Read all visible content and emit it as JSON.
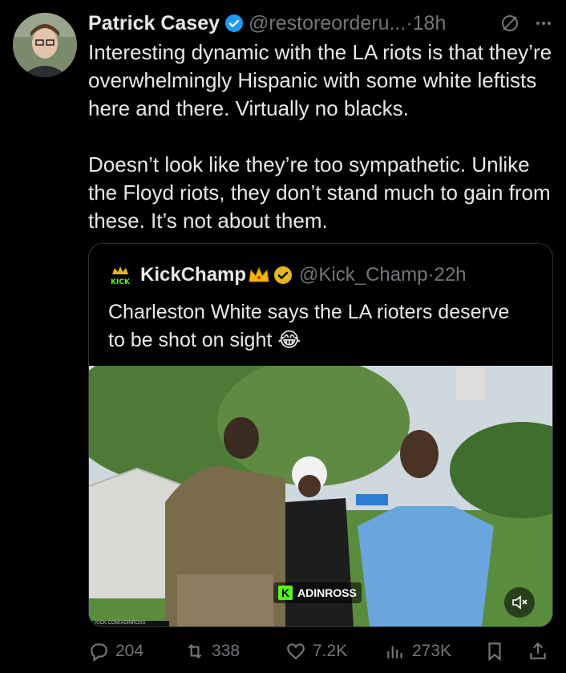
{
  "tweet": {
    "author_name": "Patrick Casey",
    "handle": "@restoreorderu...",
    "separator": "·",
    "time": "18h",
    "text": "Interesting dynamic with the LA riots is that they’re overwhelmingly Hispanic with some white leftists here and there. Virtually no blacks.\n\nDoesn’t look like they’re too sympathetic. Unlike the Floyd riots, they don’t stand much to gain from these. It’s not about them."
  },
  "quote": {
    "author_name": "KickChamp",
    "avatar_text": "KICK",
    "handle": "@Kick_Champ",
    "separator": "·",
    "time": "22h",
    "text": "Charleston White says the LA rioters deserve to be shot on sight 😂",
    "watermark": "ADINROSS",
    "watermark_logo": "K",
    "caption_strip": "KICK.COM/ADINROSS"
  },
  "actions": {
    "replies": "204",
    "reposts": "338",
    "likes": "7.2K",
    "views": "273K"
  },
  "colors": {
    "background": "#000000",
    "text": "#e7e9ea",
    "muted": "#71767b",
    "verified_blue": "#1d9bf0",
    "verified_gold": "#e2b719",
    "kick_green": "#53fc18"
  },
  "icons": [
    "verified-badge-icon",
    "grok-icon",
    "more-icon",
    "reply-icon",
    "repost-icon",
    "like-icon",
    "views-icon",
    "bookmark-icon",
    "share-icon",
    "mute-icon"
  ]
}
